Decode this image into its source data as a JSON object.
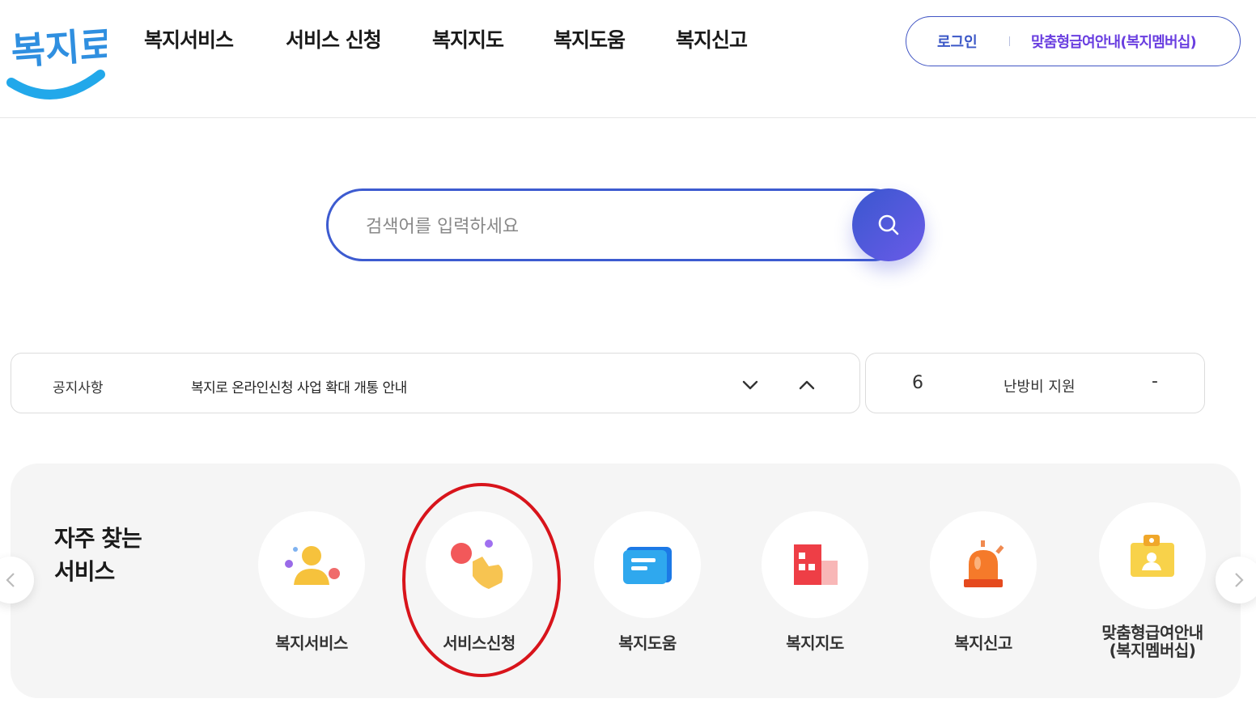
{
  "header": {
    "logo_text": "복지로",
    "nav": [
      "복지서비스",
      "서비스 신청",
      "복지지도",
      "복지도움",
      "복지신고"
    ],
    "login_label": "로그인",
    "custom_guide_label": "맞춤형급여안내(복지멤버십)"
  },
  "search": {
    "placeholder": "검색어를 입력하세요",
    "button_icon": "search-icon"
  },
  "notice": {
    "label": "공지사항",
    "text": "복지로 온라인신청 사업 확대 개통 안내"
  },
  "ranking": {
    "rank": "6",
    "keyword": "난방비 지원",
    "change": "-"
  },
  "frequent_services": {
    "title_line1": "자주 찾는",
    "title_line2": "서비스",
    "items": [
      {
        "label": "복지서비스",
        "icon": "person-icon"
      },
      {
        "label": "서비스신청",
        "icon": "hand-tap-icon"
      },
      {
        "label": "복지도움",
        "icon": "chat-bubble-icon"
      },
      {
        "label": "복지지도",
        "icon": "map-icon"
      },
      {
        "label": "복지신고",
        "icon": "siren-icon"
      },
      {
        "label_line1": "맞춤형급여안내",
        "label_line2": "(복지멤버십)",
        "icon": "id-card-icon"
      }
    ]
  },
  "colors": {
    "brand_blue": "#3d5bd0",
    "brand_purple": "#6a3fe0",
    "highlight_red": "#d8141b"
  }
}
